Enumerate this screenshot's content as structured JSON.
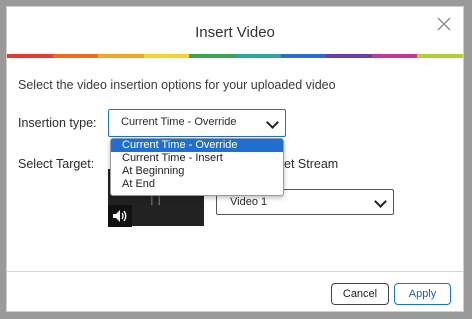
{
  "dialog": {
    "title": "Insert Video",
    "description": "Select the video insertion options for your uploaded video"
  },
  "stripe_colors": [
    "#e63b2e",
    "#f26b1d",
    "#f7a823",
    "#f2d32b",
    "#3aa64b",
    "#2aa6a1",
    "#2c6bcf",
    "#6a3fb1",
    "#c5378f",
    "#b0d131"
  ],
  "insertion": {
    "label": "Insertion type:",
    "selected": "Current Time - Override",
    "options": [
      "Current Time - Override",
      "Current Time - Insert",
      "At Beginning",
      "At End"
    ]
  },
  "target": {
    "label": "Select Target:",
    "stream_label": "et Stream",
    "stream_selected": "Video 1"
  },
  "buttons": {
    "cancel": "Cancel",
    "apply": "Apply"
  },
  "colors": {
    "accent": "#1e6fd0"
  }
}
